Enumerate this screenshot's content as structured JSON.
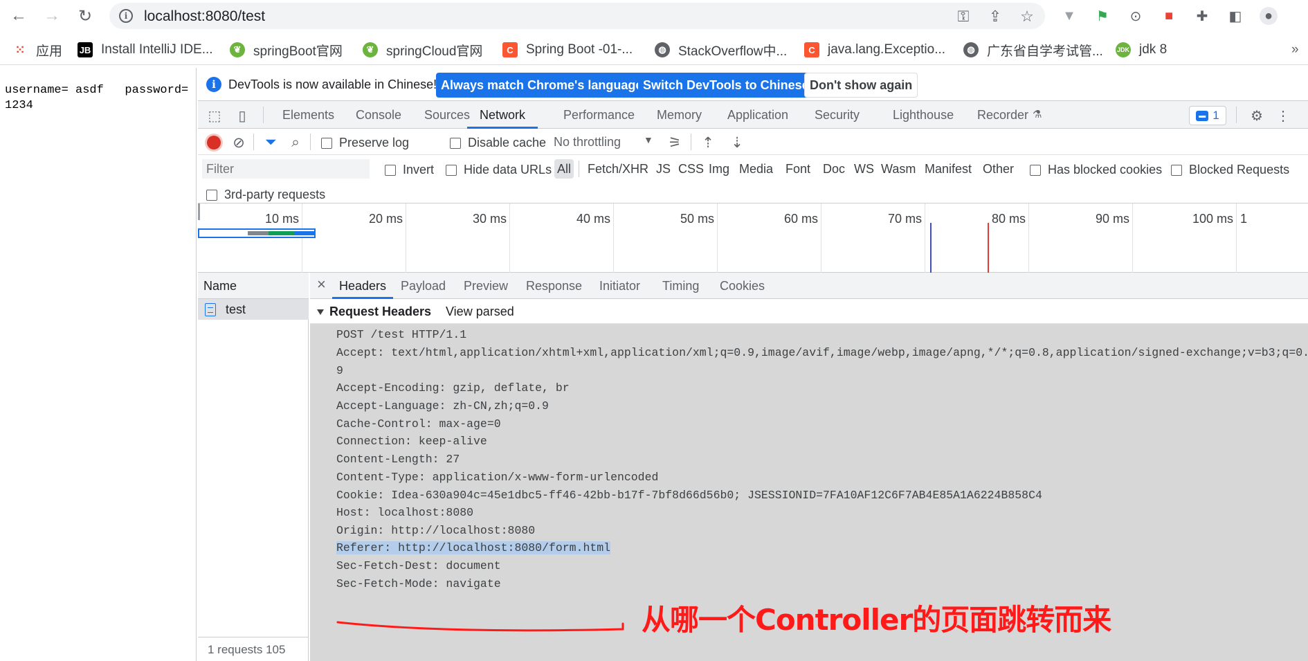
{
  "browser": {
    "url": "localhost:8080/test",
    "bookmarks": [
      {
        "label": "应用",
        "icon": "apps-grid-icon",
        "color": "#ea4335"
      },
      {
        "label": "Install IntelliJ IDE...",
        "icon": "jetbrains-icon",
        "color": "#000000"
      },
      {
        "label": "springBoot官网",
        "icon": "spring-leaf-icon",
        "color": "#6db33f"
      },
      {
        "label": "springCloud官网",
        "icon": "spring-leaf-icon",
        "color": "#6db33f"
      },
      {
        "label": "Spring Boot -01-...",
        "icon": "csdn-icon",
        "color": "#fc5531"
      },
      {
        "label": "StackOverflow中...",
        "icon": "globe-icon",
        "color": "#5f6368"
      },
      {
        "label": "java.lang.Exceptio...",
        "icon": "csdn-icon",
        "color": "#fc5531"
      },
      {
        "label": "广东省自学考试管...",
        "icon": "globe-icon",
        "color": "#5f6368"
      },
      {
        "label": "jdk 8",
        "icon": "jdk-icon",
        "color": "#6db33f"
      }
    ]
  },
  "page": {
    "text": "username= asdf   password=\n1234"
  },
  "devtools": {
    "infobar": {
      "message": "DevTools is now available in Chinese!",
      "btn_match": "Always match Chrome's language",
      "btn_switch": "Switch DevTools to Chinese",
      "btn_dismiss": "Don't show again"
    },
    "tabs": [
      "Elements",
      "Console",
      "Sources",
      "Network",
      "Performance",
      "Memory",
      "Application",
      "Security",
      "Lighthouse",
      "Recorder"
    ],
    "issues_count": "1",
    "controls": {
      "preserve_log": "Preserve log",
      "disable_cache": "Disable cache",
      "throttling": "No throttling"
    },
    "filters": {
      "placeholder": "Filter",
      "invert": "Invert",
      "hide_data_urls": "Hide data URLs",
      "types": [
        "All",
        "Fetch/XHR",
        "JS",
        "CSS",
        "Img",
        "Media",
        "Font",
        "Doc",
        "WS",
        "Wasm",
        "Manifest",
        "Other"
      ],
      "has_blocked_cookies": "Has blocked cookies",
      "blocked_requests": "Blocked Requests",
      "third_party": "3rd-party requests"
    },
    "timeline": {
      "ticks": [
        "10 ms",
        "20 ms",
        "30 ms",
        "40 ms",
        "50 ms",
        "60 ms",
        "70 ms",
        "80 ms",
        "90 ms",
        "100 ms",
        "1"
      ]
    },
    "requests": {
      "name_header": "Name",
      "rows": [
        "test"
      ],
      "status": "1 requests   105"
    },
    "detail": {
      "tabs": [
        "Headers",
        "Payload",
        "Preview",
        "Response",
        "Initiator",
        "Timing",
        "Cookies"
      ],
      "section_title": "Request Headers",
      "view_parsed": "View parsed",
      "lines": [
        "POST /test HTTP/1.1",
        "Accept: text/html,application/xhtml+xml,application/xml;q=0.9,image/avif,image/webp,image/apng,*/*;q=0.8,application/signed-exchange;v=b3;q=0.",
        "9",
        "Accept-Encoding: gzip, deflate, br",
        "Accept-Language: zh-CN,zh;q=0.9",
        "Cache-Control: max-age=0",
        "Connection: keep-alive",
        "Content-Length: 27",
        "Content-Type: application/x-www-form-urlencoded",
        "Cookie: Idea-630a904c=45e1dbc5-ff46-42bb-b17f-7bf8d66d56b0; JSESSIONID=7FA10AF12C6F7AB4E85A1A6224B858C4",
        "Host: localhost:8080",
        "Origin: http://localhost:8080",
        "Referer: http://localhost:8080/form.html",
        "Sec-Fetch-Dest: document",
        "Sec-Fetch-Mode: navigate"
      ]
    }
  },
  "annotation": "从哪一个Controller的页面跳转而来",
  "colors": {
    "accent": "#1a73e8",
    "record": "#d93025",
    "annotation": "#ff1a1a"
  }
}
